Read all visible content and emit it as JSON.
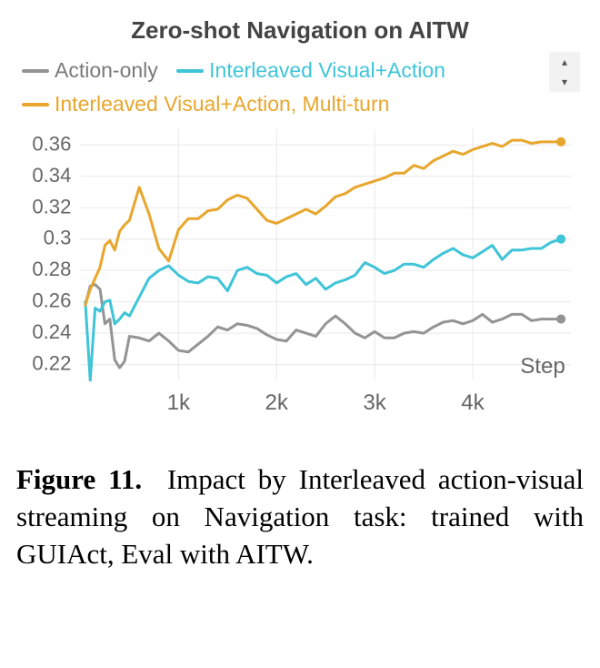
{
  "chart_data": {
    "type": "line",
    "title": "Zero-shot Navigation on AITW",
    "xlabel": "Step",
    "ylabel": "",
    "ylim": [
      0.21,
      0.37
    ],
    "xlim": [
      0,
      5000
    ],
    "yticks": [
      0.22,
      0.24,
      0.26,
      0.28,
      0.3,
      0.32,
      0.34,
      0.36
    ],
    "xticks": [
      1000,
      2000,
      3000,
      4000
    ],
    "xtick_labels": [
      "1k",
      "2k",
      "3k",
      "4k"
    ],
    "x": [
      50,
      100,
      150,
      200,
      250,
      300,
      350,
      400,
      450,
      500,
      600,
      700,
      800,
      900,
      1000,
      1100,
      1200,
      1300,
      1400,
      1500,
      1600,
      1700,
      1800,
      1900,
      2000,
      2100,
      2200,
      2300,
      2400,
      2500,
      2600,
      2700,
      2800,
      2900,
      3000,
      3100,
      3200,
      3300,
      3400,
      3500,
      3600,
      3700,
      3800,
      3900,
      4000,
      4100,
      4200,
      4300,
      4400,
      4500,
      4600,
      4700,
      4800,
      4900
    ],
    "series": [
      {
        "name": "Action-only",
        "color": "#949494",
        "values": [
          0.258,
          0.27,
          0.271,
          0.268,
          0.246,
          0.249,
          0.223,
          0.218,
          0.222,
          0.238,
          0.237,
          0.235,
          0.24,
          0.235,
          0.229,
          0.228,
          0.233,
          0.238,
          0.244,
          0.242,
          0.246,
          0.245,
          0.243,
          0.239,
          0.236,
          0.235,
          0.242,
          0.24,
          0.238,
          0.246,
          0.251,
          0.246,
          0.24,
          0.237,
          0.241,
          0.237,
          0.237,
          0.24,
          0.241,
          0.24,
          0.244,
          0.247,
          0.248,
          0.246,
          0.248,
          0.252,
          0.247,
          0.249,
          0.252,
          0.252,
          0.248,
          0.249,
          0.249,
          0.249
        ]
      },
      {
        "name": "Interleaved Visual+Action",
        "color": "#3fc4d8",
        "values": [
          0.26,
          0.21,
          0.256,
          0.254,
          0.26,
          0.261,
          0.246,
          0.249,
          0.253,
          0.251,
          0.263,
          0.275,
          0.28,
          0.283,
          0.277,
          0.273,
          0.272,
          0.276,
          0.275,
          0.267,
          0.28,
          0.282,
          0.278,
          0.277,
          0.272,
          0.276,
          0.278,
          0.271,
          0.275,
          0.268,
          0.272,
          0.274,
          0.277,
          0.285,
          0.282,
          0.278,
          0.28,
          0.284,
          0.284,
          0.282,
          0.287,
          0.291,
          0.294,
          0.29,
          0.288,
          0.292,
          0.296,
          0.287,
          0.293,
          0.293,
          0.294,
          0.294,
          0.298,
          0.3
        ]
      },
      {
        "name": "Interleaved Visual+Action, Multi-turn",
        "color": "#e8a62d",
        "values": [
          0.258,
          0.268,
          0.275,
          0.282,
          0.296,
          0.299,
          0.293,
          0.305,
          0.309,
          0.312,
          0.333,
          0.316,
          0.294,
          0.286,
          0.306,
          0.313,
          0.313,
          0.318,
          0.319,
          0.325,
          0.328,
          0.326,
          0.319,
          0.312,
          0.31,
          0.313,
          0.316,
          0.319,
          0.316,
          0.321,
          0.327,
          0.329,
          0.333,
          0.335,
          0.337,
          0.339,
          0.342,
          0.342,
          0.347,
          0.345,
          0.35,
          0.353,
          0.356,
          0.354,
          0.357,
          0.359,
          0.361,
          0.359,
          0.363,
          0.363,
          0.361,
          0.362,
          0.362,
          0.362
        ]
      }
    ]
  },
  "caption": {
    "label": "Figure 11.",
    "text": "Impact by Interleaved action-visual streaming on Navigation task: trained with GUIAct, Eval with AITW."
  }
}
